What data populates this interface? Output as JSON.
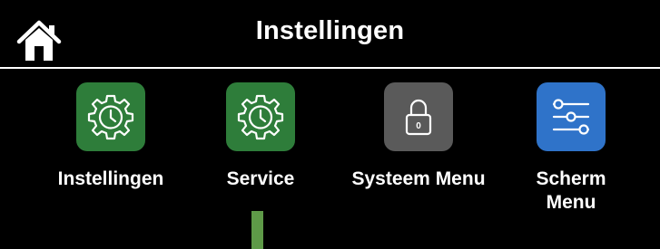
{
  "header": {
    "title": "Instellingen",
    "home_icon": "home-icon"
  },
  "colors": {
    "background": "#000000",
    "text": "#ffffff",
    "green_tile": "#2e7d3a",
    "gray_tile": "#5a5a5a",
    "blue_tile": "#2f73c9",
    "indicator": "#5e9a48"
  },
  "menu": {
    "items": [
      {
        "label": "Instellingen",
        "icon": "gear-clock-icon",
        "tile_color": "green"
      },
      {
        "label": "Service",
        "icon": "gear-clock-icon",
        "tile_color": "green"
      },
      {
        "label": "Systeem Menu",
        "icon": "padlock-icon",
        "lock_text": "0",
        "tile_color": "gray"
      },
      {
        "label": "Scherm\nMenu",
        "icon": "sliders-icon",
        "tile_color": "blue"
      }
    ]
  }
}
